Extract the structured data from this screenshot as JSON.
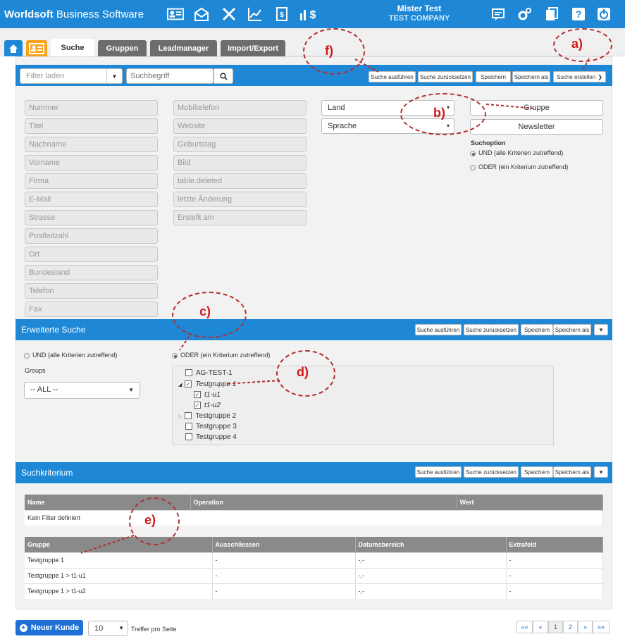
{
  "brand": {
    "bold": "Worldsoft",
    "rest": " Business Software"
  },
  "topnav": {
    "icons": [
      "contacts-icon",
      "mail-icon",
      "tools-icon",
      "chart-icon",
      "invoice-icon",
      "finance-icon"
    ]
  },
  "user": {
    "name": "Mister Test",
    "company": "TEST COMPANY"
  },
  "right_icons": [
    "message-icon",
    "gear-icon",
    "document-icon",
    "help-icon",
    "power-icon"
  ],
  "tabs": [
    "Suche",
    "Gruppen",
    "Leadmanager",
    "Import/Export"
  ],
  "search": {
    "filter_placeholder": "Filter laden",
    "term_placeholder": "Suchbegriff"
  },
  "actions": {
    "run": "Suche ausführen",
    "reset": "Suche zurücksetzen",
    "save": "Speichern",
    "save_as": "Speichern als",
    "create": "Suche erstellen"
  },
  "fields_left": [
    "Nummer",
    "Titel",
    "Nachname",
    "Vorname",
    "Firma",
    "E-Mail",
    "Strasse",
    "Postleitzahl",
    "Ort",
    "Bundesland",
    "Telefon",
    "Fax"
  ],
  "fields_mid": [
    "Mobiltelefon",
    "Website",
    "Geburtstag",
    "Bild",
    "table.deleted",
    "letzte Änderung",
    "Erstellt am"
  ],
  "selects": {
    "land": "Land",
    "sprache": "Sprache"
  },
  "buttons": {
    "gruppe": "Gruppe",
    "newsletter": "Newsletter"
  },
  "suchoption": {
    "label": "Suchoption",
    "und": "UND (alle Kriterien zutreffend)",
    "oder": "ODER (ein Kriterium zutreffend)"
  },
  "erweitert": {
    "title": "Erweiterte Suche",
    "und": "UND (alle Kriterien zutreffend)",
    "oder": "ODER (ein Kriterium zutreffend)",
    "groups_label": "Groups",
    "groups_value": "-- ALL --"
  },
  "tree": [
    {
      "label": "AG-TEST-1",
      "checked": false
    },
    {
      "label": "Testgruppe 1",
      "checked": true
    },
    {
      "label": "t1-u1",
      "checked": true
    },
    {
      "label": "t1-u2",
      "checked": true
    },
    {
      "label": "Testgruppe 2",
      "checked": false
    },
    {
      "label": "Testgruppe 3",
      "checked": false
    },
    {
      "label": "Testgruppe 4",
      "checked": false
    }
  ],
  "kriterium": {
    "title": "Suchkriterium",
    "filter_headers": [
      "Name",
      "Operation",
      "Wert"
    ],
    "no_filter": "Kein Filter definiert",
    "group_headers": [
      "Gruppe",
      "Ausschliessen",
      "Datumsbereich",
      "Extrafeld"
    ],
    "group_rows": [
      [
        "Testgruppe 1",
        "-",
        "-,-",
        "-"
      ],
      [
        "Testgruppe 1 > t1-u1",
        "-",
        "-,-",
        "-"
      ],
      [
        "Testgruppe 1 > t1-u2",
        "-",
        "-,-",
        "-"
      ]
    ]
  },
  "footer": {
    "new_customer": "Neuer Kunde",
    "per_page": "10",
    "per_page_label": "Treffer pro Seite",
    "pager": [
      "««",
      "«",
      "1",
      "2",
      "»",
      "»»"
    ]
  },
  "annotations": [
    "a)",
    "b)",
    "c)",
    "d)",
    "e)",
    "f)"
  ]
}
